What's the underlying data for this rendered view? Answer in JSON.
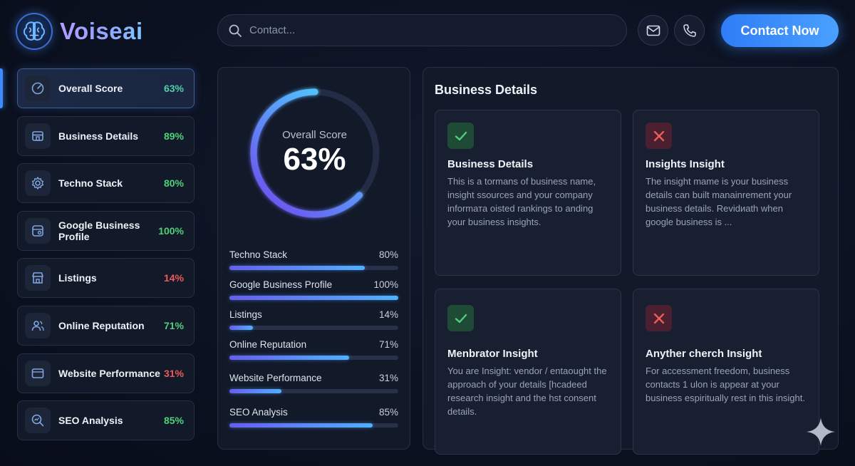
{
  "brand": {
    "name": "Voiseai",
    "logo_icon": "brain-icon"
  },
  "search": {
    "placeholder": "Contact...",
    "icon": "search-icon"
  },
  "header": {
    "mail_icon": "mail-icon",
    "phone_icon": "phone-icon",
    "contact_label": "Contact Now"
  },
  "sidebar": {
    "items": [
      {
        "label": "Overall Score",
        "pct": "63%",
        "icon": "gauge-icon",
        "color": "#4fd1a5",
        "active": true
      },
      {
        "label": "Business Details",
        "pct": "89%",
        "icon": "storefront-icon",
        "color": "#4fd17a"
      },
      {
        "label": "Techno Stack",
        "pct": "80%",
        "icon": "gear-icon",
        "color": "#4fd17a"
      },
      {
        "label": "Google Business Profile",
        "pct": "100%",
        "icon": "business-profile-icon",
        "color": "#4fd17a"
      },
      {
        "label": "Listings",
        "pct": "14%",
        "icon": "store-icon",
        "color": "#ef5a5a"
      },
      {
        "label": "Online Reputation",
        "pct": "71%",
        "icon": "users-icon",
        "color": "#4fd17a"
      },
      {
        "label": "Website Performance",
        "pct": "31%",
        "icon": "browser-icon",
        "color": "#ef5a5a"
      },
      {
        "label": "SEO Analysis",
        "pct": "85%",
        "icon": "seo-search-icon",
        "color": "#4fd17a"
      }
    ]
  },
  "score": {
    "title": "Overall Score",
    "value": "63%",
    "fraction": 0.63,
    "bars": [
      {
        "label": "Techno Stack",
        "pct": "80%",
        "fraction": 0.8
      },
      {
        "label": "Google Business Profile",
        "pct": "100%",
        "fraction": 1.0
      },
      {
        "label": "Listings",
        "pct": "14%",
        "fraction": 0.14
      },
      {
        "label": "Online Reputation",
        "pct": "71%",
        "fraction": 0.71
      },
      {
        "label": "Website Performance",
        "pct": "31%",
        "fraction": 0.31
      },
      {
        "label": "SEO Analysis",
        "pct": "85%",
        "fraction": 0.85
      }
    ]
  },
  "details": {
    "title": "Business Details",
    "cards": [
      {
        "status": "check",
        "title": "Business Details",
        "body": "This is a tormans of business name, insight ssources and your company informатa oisted rankings to anding your business insights."
      },
      {
        "status": "cross",
        "title": "Insights Insight",
        "body": "The insight mame is your business details can built manainrement your business details. Revidиаth when google business is ..."
      },
      {
        "status": "check",
        "title": "Menbrator Insight",
        "body": "You are Insight: vendor / entaought the approach of your details [hcadeed research insight and the hst consent details."
      },
      {
        "status": "cross",
        "title": "Anyther cherch Insight",
        "body": "For accessment freedom, business contacts 1 ulon is appear at your business espiritually rest in this insight."
      }
    ]
  },
  "colors": {
    "accent": "#3d8bff",
    "good": "#4fd17a",
    "bad": "#ef5a5a",
    "check_icon": "check-icon",
    "cross_icon": "close-icon",
    "sparkle_icon": "sparkle-icon"
  }
}
